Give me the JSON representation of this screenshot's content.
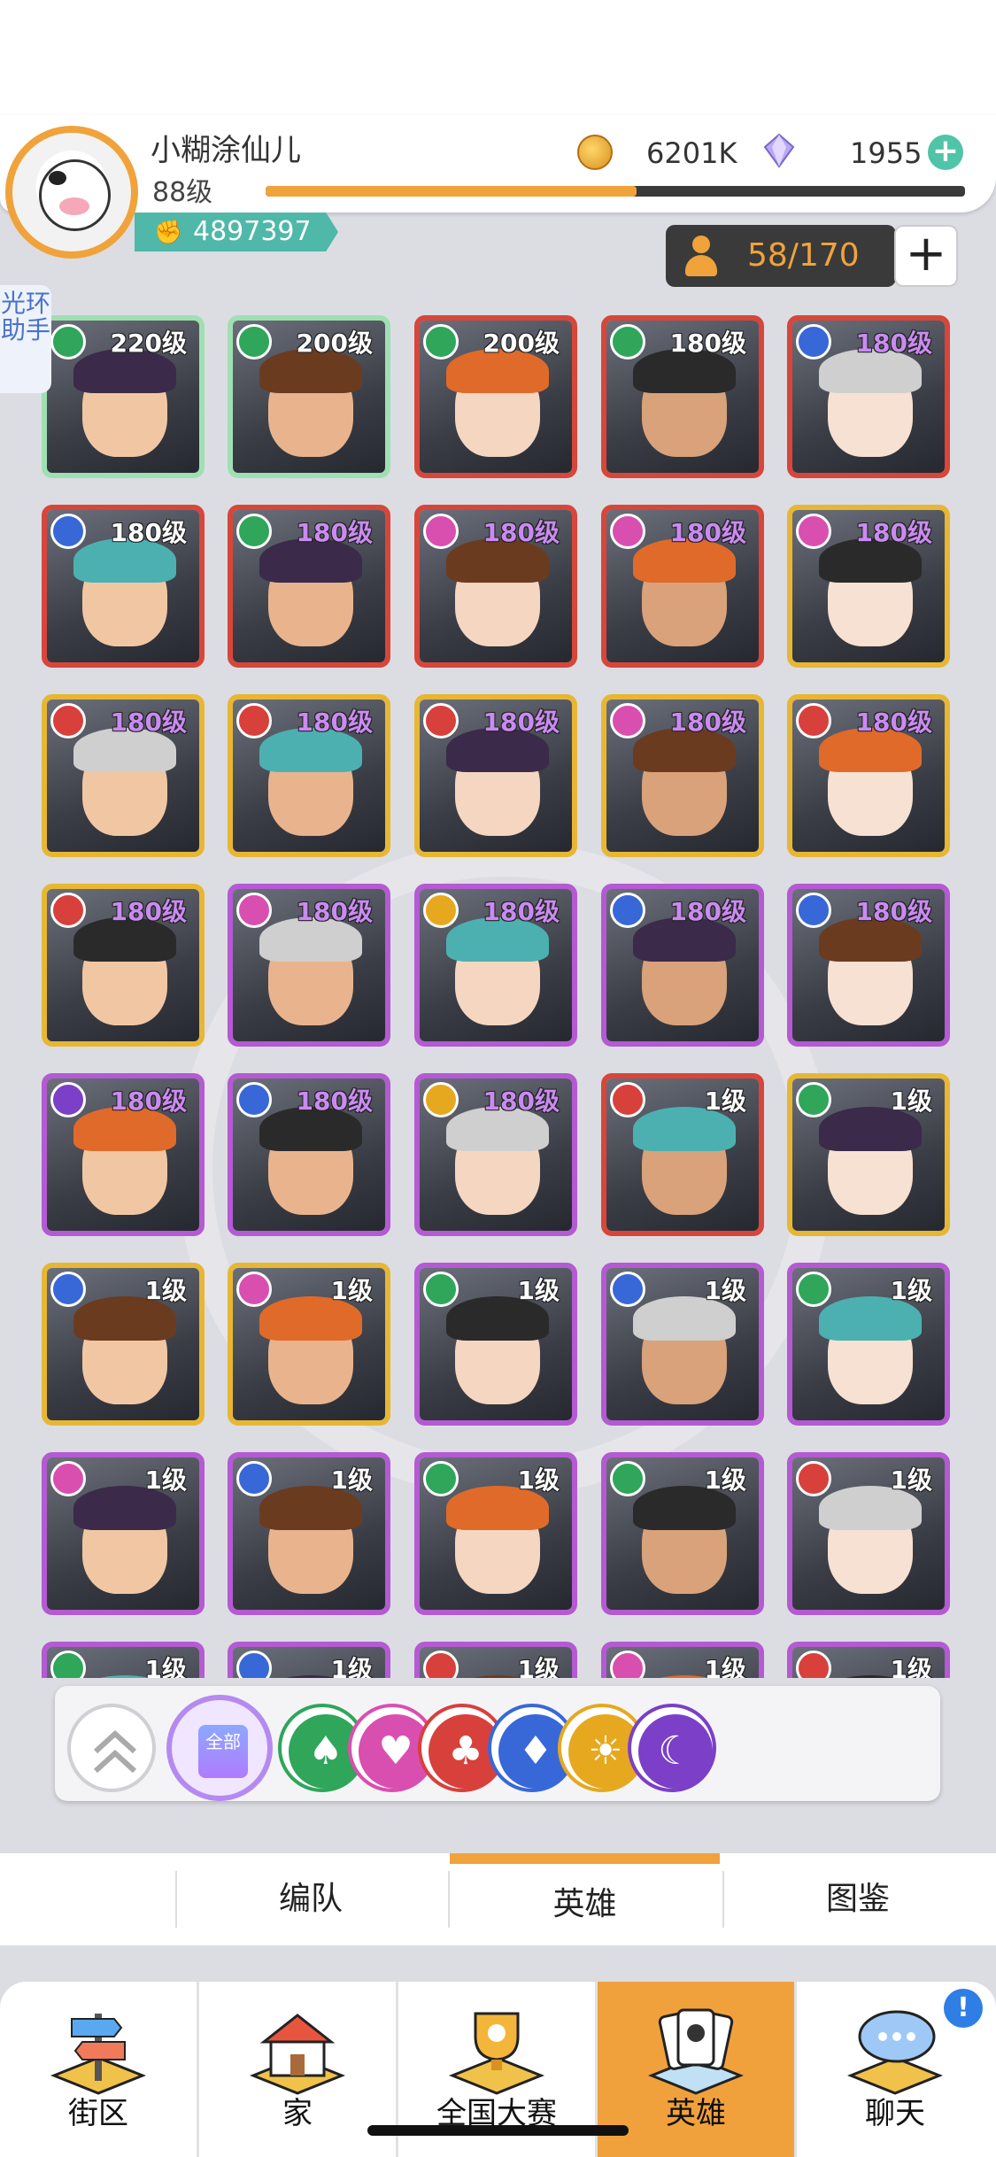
{
  "profile": {
    "name": "小糊涂仙儿",
    "level": "88级",
    "power": "4897397",
    "xp_fraction": 0.53
  },
  "currency": {
    "coins": "6201K",
    "gems": "1955",
    "coin_icon": "gold-coin-icon",
    "gem_icon": "diamond-gem-icon"
  },
  "roster": {
    "count": "58/170"
  },
  "side_tab": {
    "label": "光环助手"
  },
  "factions": {
    "green": "#2fa65a",
    "pink": "#d94fb0",
    "red": "#d8403c",
    "blue": "#3868d8",
    "gold": "#e6a81f",
    "purple": "#7b3fc8"
  },
  "heroes": [
    {
      "level": "220级",
      "frame": "green",
      "faction": "green",
      "level_color": "white"
    },
    {
      "level": "200级",
      "frame": "green",
      "faction": "green",
      "level_color": "white"
    },
    {
      "level": "200级",
      "frame": "red",
      "faction": "green",
      "level_color": "white"
    },
    {
      "level": "180级",
      "frame": "red",
      "faction": "green",
      "level_color": "white"
    },
    {
      "level": "180级",
      "frame": "red",
      "faction": "blue",
      "level_color": "violet"
    },
    {
      "level": "180级",
      "frame": "red",
      "faction": "blue",
      "level_color": "white"
    },
    {
      "level": "180级",
      "frame": "red",
      "faction": "green",
      "level_color": "violet"
    },
    {
      "level": "180级",
      "frame": "red",
      "faction": "pink",
      "level_color": "violet"
    },
    {
      "level": "180级",
      "frame": "red",
      "faction": "pink",
      "level_color": "violet"
    },
    {
      "level": "180级",
      "frame": "gold",
      "faction": "pink",
      "level_color": "violet"
    },
    {
      "level": "180级",
      "frame": "gold",
      "faction": "red",
      "level_color": "violet"
    },
    {
      "level": "180级",
      "frame": "gold",
      "faction": "red",
      "level_color": "violet"
    },
    {
      "level": "180级",
      "frame": "gold",
      "faction": "red",
      "level_color": "violet"
    },
    {
      "level": "180级",
      "frame": "gold",
      "faction": "pink",
      "level_color": "violet"
    },
    {
      "level": "180级",
      "frame": "gold",
      "faction": "red",
      "level_color": "violet"
    },
    {
      "level": "180级",
      "frame": "gold",
      "faction": "red",
      "level_color": "violet"
    },
    {
      "level": "180级",
      "frame": "purple",
      "faction": "pink",
      "level_color": "violet"
    },
    {
      "level": "180级",
      "frame": "purple",
      "faction": "gold",
      "level_color": "violet"
    },
    {
      "level": "180级",
      "frame": "purple",
      "faction": "blue",
      "level_color": "violet"
    },
    {
      "level": "180级",
      "frame": "purple",
      "faction": "blue",
      "level_color": "violet"
    },
    {
      "level": "180级",
      "frame": "purple",
      "faction": "purple",
      "level_color": "violet"
    },
    {
      "level": "180级",
      "frame": "purple",
      "faction": "blue",
      "level_color": "violet"
    },
    {
      "level": "180级",
      "frame": "purple",
      "faction": "gold",
      "level_color": "violet"
    },
    {
      "level": "1级",
      "frame": "red",
      "faction": "red",
      "level_color": "white"
    },
    {
      "level": "1级",
      "frame": "gold",
      "faction": "green",
      "level_color": "white"
    },
    {
      "level": "1级",
      "frame": "gold",
      "faction": "blue",
      "level_color": "white"
    },
    {
      "level": "1级",
      "frame": "gold",
      "faction": "pink",
      "level_color": "white"
    },
    {
      "level": "1级",
      "frame": "purple",
      "faction": "green",
      "level_color": "white"
    },
    {
      "level": "1级",
      "frame": "purple",
      "faction": "blue",
      "level_color": "white"
    },
    {
      "level": "1级",
      "frame": "purple",
      "faction": "green",
      "level_color": "white"
    },
    {
      "level": "1级",
      "frame": "purple",
      "faction": "pink",
      "level_color": "white"
    },
    {
      "level": "1级",
      "frame": "purple",
      "faction": "blue",
      "level_color": "white"
    },
    {
      "level": "1级",
      "frame": "purple",
      "faction": "green",
      "level_color": "white"
    },
    {
      "level": "1级",
      "frame": "purple",
      "faction": "green",
      "level_color": "white"
    },
    {
      "level": "1级",
      "frame": "purple",
      "faction": "red",
      "level_color": "white"
    },
    {
      "level": "1级",
      "frame": "purple",
      "faction": "green",
      "level_color": "white"
    },
    {
      "level": "1级",
      "frame": "purple",
      "faction": "blue",
      "level_color": "white"
    },
    {
      "level": "1级",
      "frame": "purple",
      "faction": "red",
      "level_color": "white"
    },
    {
      "level": "1级",
      "frame": "purple",
      "faction": "pink",
      "level_color": "white"
    },
    {
      "level": "1级",
      "frame": "purple",
      "faction": "red",
      "level_color": "white"
    }
  ],
  "filters": {
    "all_label": "全部",
    "items": [
      "green",
      "pink",
      "red",
      "blue",
      "gold",
      "purple"
    ]
  },
  "tabs": [
    "编队",
    "英雄",
    "图鉴"
  ],
  "active_tab": 1,
  "nav": [
    {
      "label": "街区",
      "icon": "street-signpost-icon"
    },
    {
      "label": "家",
      "icon": "house-icon"
    },
    {
      "label": "全国大赛",
      "icon": "trophy-icon"
    },
    {
      "label": "英雄",
      "icon": "hero-cards-icon"
    },
    {
      "label": "聊天",
      "icon": "chat-bubble-icon"
    }
  ],
  "active_nav": 3,
  "chat_badge": "!"
}
